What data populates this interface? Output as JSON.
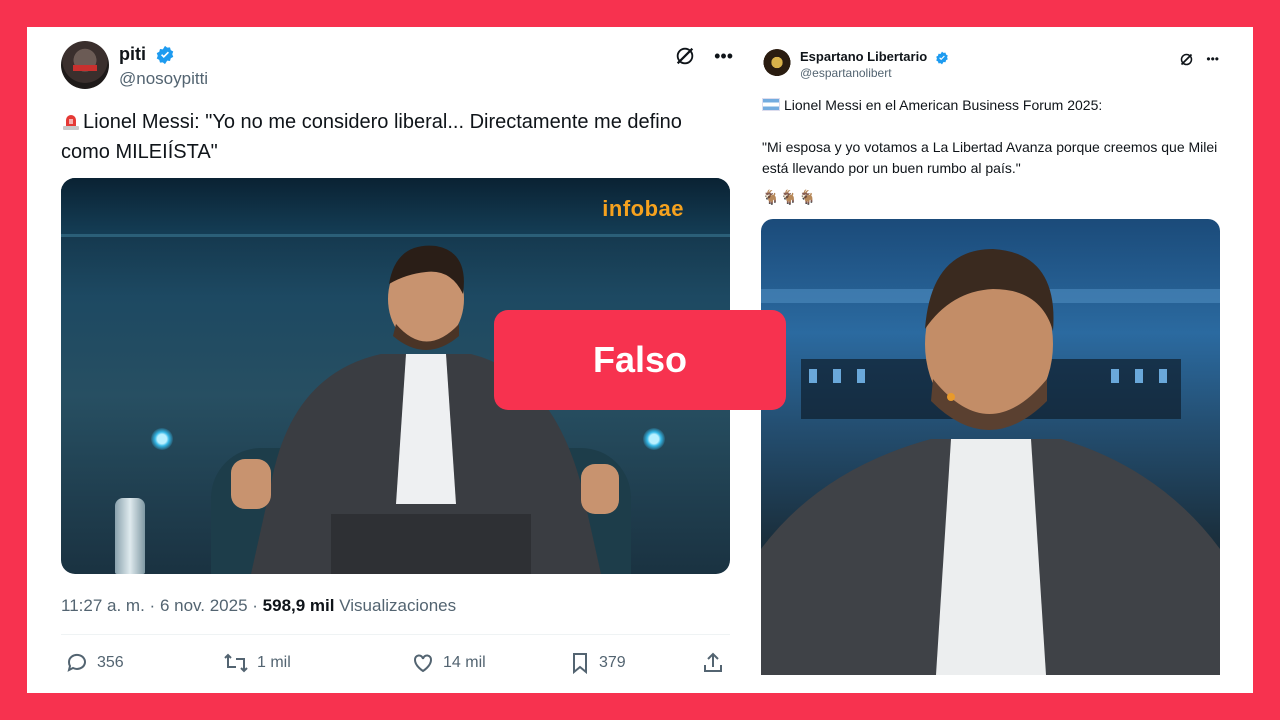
{
  "colors": {
    "frame": "#f7324f",
    "badge": "#f7324f",
    "verified": "#1d9bf0",
    "infobae": "#f6a21e"
  },
  "left_tweet": {
    "name": "piti",
    "handle": "@nosoypitti",
    "text": "Lionel Messi: \"Yo no me considero liberal... Directamente me defino como MILEIÍSTA\"",
    "text_icon": "rotating-light-emoji",
    "media_watermark": "infobae",
    "time": "11:27 a. m.",
    "date": "6 nov. 2025",
    "views_count": "598,9 mil",
    "views_label": "Visualizaciones",
    "sep": "·",
    "actions": {
      "replies": "356",
      "retweets": "1 mil",
      "likes": "14 mil",
      "bookmarks": "379"
    }
  },
  "right_tweet": {
    "name": "Espartano Libertario",
    "handle": "@espartanolibert",
    "line1": "Lionel Messi en el American Business Forum 2025:",
    "line2": "\"Mi esposa y yo votamos a La Libertad Avanza porque creemos que Milei está llevando por un buen rumbo al país.\"",
    "emoji_line": "🐐🐐🐐",
    "flag_icon": "argentina-flag-emoji"
  },
  "badge": {
    "label": "Falso"
  }
}
